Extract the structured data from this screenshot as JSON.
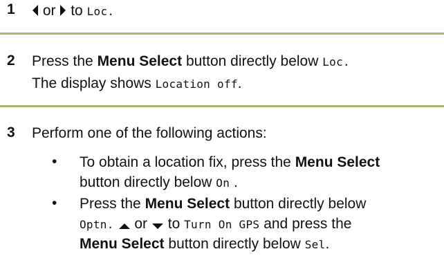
{
  "rule_color": "#a7b86e",
  "step1": {
    "number": "1",
    "word_or": "or",
    "word_to": "to",
    "code_loc": "Loc."
  },
  "step2": {
    "number": "2",
    "line1_pre": "Press the",
    "line1_bold": "Menu Select",
    "line1_post": "button directly below",
    "line1_code": "Loc.",
    "line2_pre": "The display shows",
    "line2_code": "Location off",
    "line2_post": "."
  },
  "step3": {
    "number": "3",
    "intro": "Perform one of the following actions:",
    "bullet_glyph": "•",
    "bullet1": {
      "line1_pre": "To obtain a location fix, press the",
      "line1_bold": "Menu Select",
      "line2_pre": "button directly below",
      "line2_code": "On",
      "line2_post": " ."
    },
    "bullet2": {
      "line1_pre": "Press the",
      "line1_bold": "Menu Select",
      "line1_post": "button directly below",
      "line2_code": "Optn.",
      "line2_or": "or",
      "line2_to": "to",
      "line2_code2": "Turn On GPS",
      "line2_post": "and press the",
      "line3_bold": "Menu Select",
      "line3_pre": "button directly below",
      "line3_code": "Sel",
      "line3_post": "."
    }
  }
}
